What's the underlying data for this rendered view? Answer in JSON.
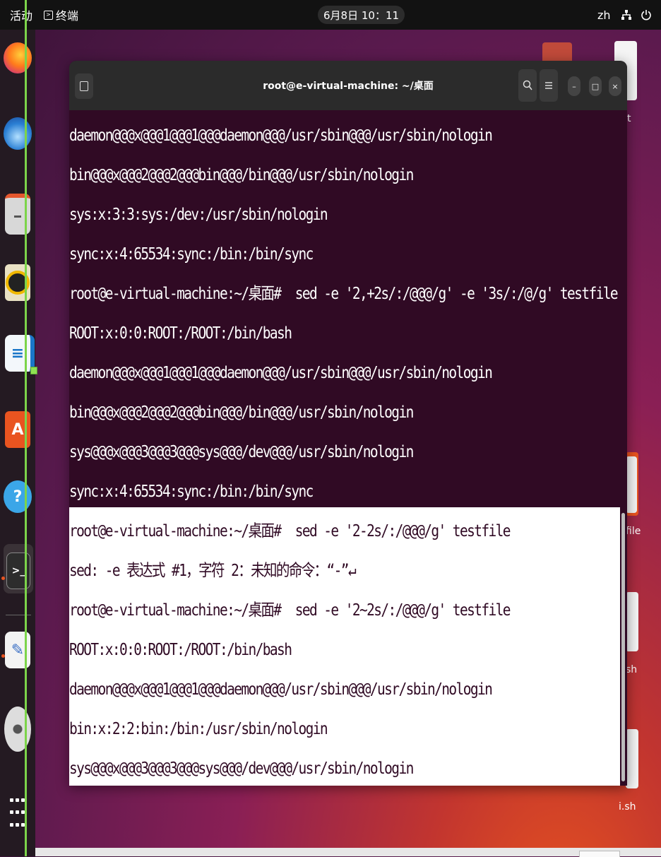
{
  "topbar": {
    "activities": "活动",
    "app_icon": "terminal-icon",
    "app_name": "终端",
    "clock": "6月8日 10：11",
    "input_lang": "zh",
    "network_icon": "network-icon",
    "power_icon": "power-icon"
  },
  "dock": {
    "apps": [
      "firefox",
      "thunderbird",
      "files",
      "rhythmbox",
      "libreoffice-writer",
      "app-center",
      "help",
      "terminal",
      "text-editor",
      "disc"
    ],
    "show_apps_icon": "grid-icon"
  },
  "desktop": {
    "labels": [
      "t",
      "file",
      "sh",
      "i.sh"
    ]
  },
  "window": {
    "title": "root@e-virtual-machine: ~/桌面",
    "new_tab_icon": "new-tab-icon",
    "search_icon": "search-icon",
    "menu_icon": "hamburger-menu-icon",
    "minimize": "–",
    "maximize": "□",
    "close": "×"
  },
  "terminal": {
    "colors": {
      "background": "#300a24",
      "text": "#ffffff",
      "selection": "#ffffff",
      "selection_text": "#300a24"
    },
    "lines": [
      "daemon@@@x@@@1@@@1@@@daemon@@@/usr/sbin@@@/usr/sbin/nologin",
      "bin@@@x@@@2@@@2@@@bin@@@/bin@@@/usr/sbin/nologin",
      "sys:x:3:3:sys:/dev:/usr/sbin/nologin",
      "sync:x:4:65534:sync:/bin:/bin/sync",
      "root@e-virtual-machine:~/桌面#  sed -e '2,+2s/:/@@@/g' -e '3s/:/@/g' testfile",
      "ROOT:x:0:0:ROOT:/ROOT:/bin/bash",
      "daemon@@@x@@@1@@@1@@@daemon@@@/usr/sbin@@@/usr/sbin/nologin",
      "bin@@@x@@@2@@@2@@@bin@@@/bin@@@/usr/sbin/nologin",
      "sys@@@x@@@3@@@3@@@sys@@@/dev@@@/usr/sbin/nologin",
      "sync:x:4:65534:sync:/bin:/bin/sync",
      "root@e-virtual-machine:~/桌面#  sed -e '2-2s/:/@@@/g' testfile",
      "sed: -e 表达式 #1，字符 2：未知的命令：“-”↵",
      "root@e-virtual-machine:~/桌面#  sed -e '2~2s/:/@@@/g' testfile",
      "ROOT:x:0:0:ROOT:/ROOT:/bin/bash",
      "daemon@@@x@@@1@@@1@@@daemon@@@/usr/sbin@@@/usr/sbin/nologin",
      "bin:x:2:2:bin:/bin:/usr/sbin/nologin",
      "sys@@@x@@@3@@@3@@@sys@@@/dev@@@/usr/sbin/nologin"
    ]
  }
}
